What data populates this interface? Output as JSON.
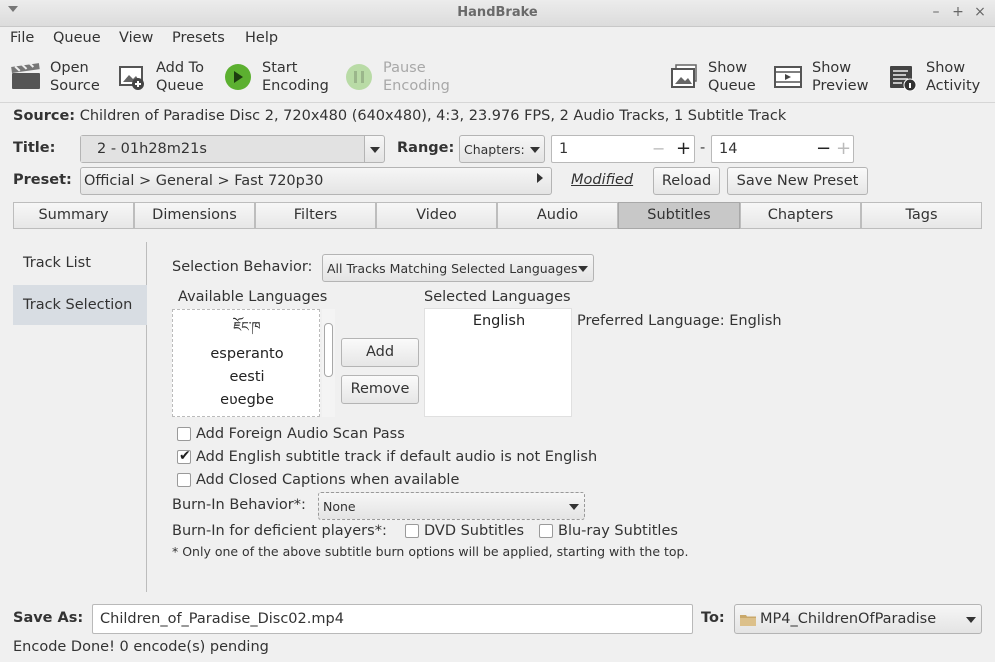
{
  "window": {
    "title": "HandBrake"
  },
  "menu": {
    "file": "File",
    "queue": "Queue",
    "view": "View",
    "presets": "Presets",
    "help": "Help"
  },
  "toolbar": {
    "open_source": [
      "Open",
      "Source"
    ],
    "add_to_queue": [
      "Add To",
      "Queue"
    ],
    "start_encoding": [
      "Start",
      "Encoding"
    ],
    "pause_encoding": [
      "Pause",
      "Encoding"
    ],
    "show_queue": [
      "Show",
      "Queue"
    ],
    "show_preview": [
      "Show",
      "Preview"
    ],
    "show_activity": [
      "Show",
      "Activity"
    ]
  },
  "source": {
    "label": "Source:",
    "value": "Children of Paradise Disc 2, 720x480 (640x480), 4:3, 23.976 FPS, 2 Audio Tracks, 1 Subtitle Track"
  },
  "title_row": {
    "label": "Title:",
    "title_value": "2 - 01h28m21s",
    "range_label": "Range:",
    "range_type": "Chapters:",
    "range_start": "1",
    "range_sep": "-",
    "range_end": "14"
  },
  "preset_row": {
    "label": "Preset:",
    "value": "Official > General > Fast 720p30",
    "modified": "Modified",
    "reload": "Reload",
    "save_new": "Save New Preset"
  },
  "tabs": [
    "Summary",
    "Dimensions",
    "Filters",
    "Video",
    "Audio",
    "Subtitles",
    "Chapters",
    "Tags"
  ],
  "active_tab": "Subtitles",
  "side": {
    "items": [
      "Track List",
      "Track Selection"
    ],
    "active": "Track Selection"
  },
  "subtitles": {
    "selection_behavior_label": "Selection Behavior:",
    "selection_behavior_value": "All Tracks Matching Selected Languages",
    "available_label": "Available Languages",
    "available": [
      "ཇོང་ཁ",
      "esperanto",
      "eesti",
      "eʋegbe"
    ],
    "selected_label": "Selected Languages",
    "selected": [
      "English"
    ],
    "add_button": "Add",
    "remove_button": "Remove",
    "preferred_language": "Preferred Language: English",
    "opt_foreign_scan": {
      "label": "Add Foreign Audio Scan Pass",
      "checked": false
    },
    "opt_english_track": {
      "label": "Add English subtitle track if default audio is not English",
      "checked": true
    },
    "opt_closed_captions": {
      "label": "Add Closed Captions when available",
      "checked": false
    },
    "burn_in_label": "Burn-In Behavior*:",
    "burn_in_value": "None",
    "deficient_label": "Burn-In for deficient players*:",
    "dvd_subtitles": {
      "label": "DVD Subtitles",
      "checked": false
    },
    "bluray_subtitles": {
      "label": "Blu-ray Subtitles",
      "checked": false
    },
    "footnote": "* Only one of the above subtitle burn options will be applied, starting with the top."
  },
  "save": {
    "label": "Save As:",
    "filename": "Children_of_Paradise_Disc02.mp4",
    "to_label": "To:",
    "destination": "MP4_ChildrenOfParadise"
  },
  "status": "Encode Done! 0 encode(s) pending",
  "colors": {
    "start_green": "#5cb030",
    "active_tab": "#c8c8c8",
    "selected_side": "#d8dde3",
    "folder": "#c9a86a"
  }
}
